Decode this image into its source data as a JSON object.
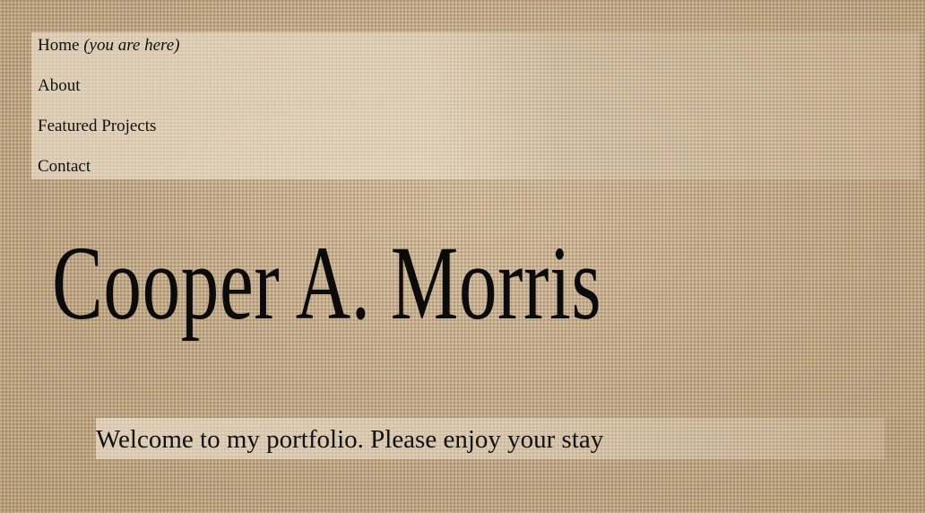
{
  "nav": {
    "items": [
      {
        "label": "Home",
        "note": "(you are here)",
        "current": true
      },
      {
        "label": "About"
      },
      {
        "label": "Featured Projects"
      },
      {
        "label": "Contact"
      }
    ]
  },
  "hero": {
    "name": "Cooper A. Morris"
  },
  "welcome": {
    "text": "Welcome to my portfolio. Please enjoy your stay"
  }
}
